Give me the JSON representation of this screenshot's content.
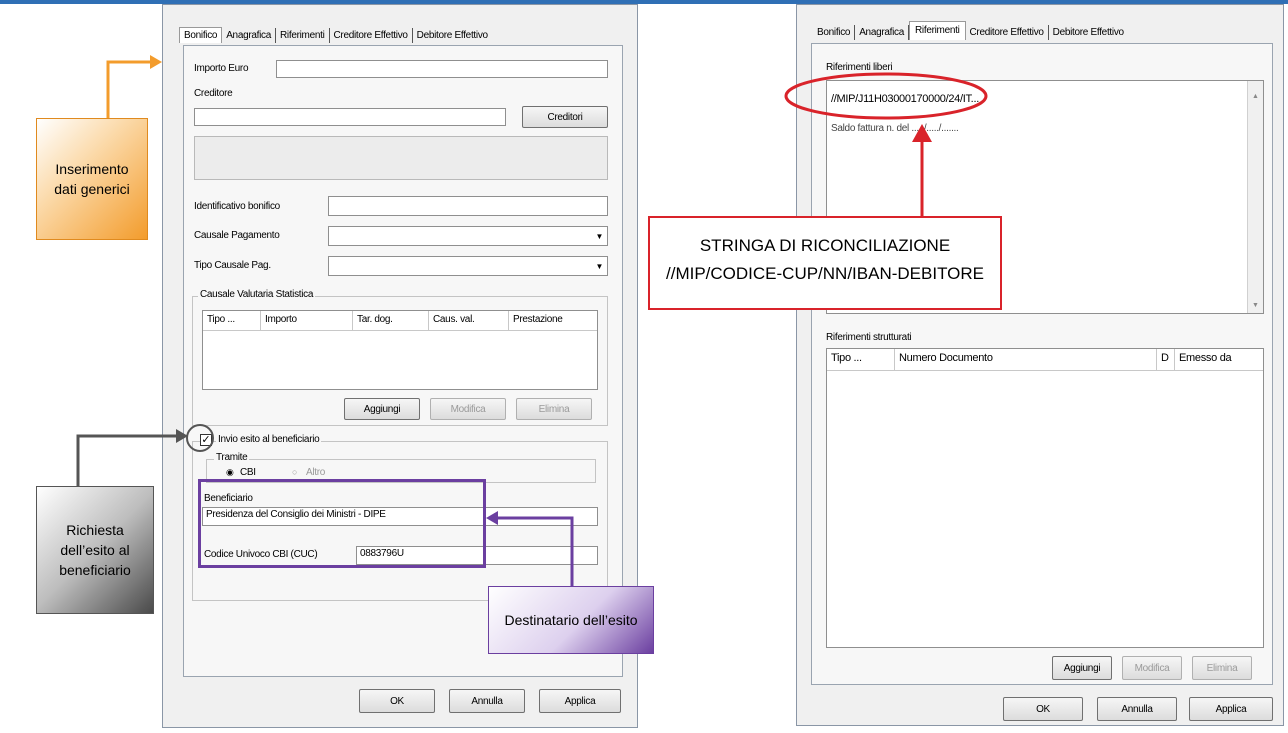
{
  "left_dialog": {
    "tabs": [
      "Bonifico",
      "Anagrafica",
      "Riferimenti",
      "Creditore Effettivo",
      "Debitore Effettivo"
    ],
    "importo_label": "Importo Euro",
    "importo_value": "",
    "creditore_label": "Creditore",
    "creditore_value": "",
    "creditori_button": "Creditori",
    "identificativo_label": "Identificativo bonifico",
    "identificativo_value": "",
    "causale_pagamento_label": "Causale Pagamento",
    "causale_pagamento_value": "",
    "tipo_causale_label": "Tipo Causale Pag.",
    "tipo_causale_value": "",
    "valutaria": {
      "title": "Causale Valutaria Statistica",
      "columns": [
        "Tipo ...",
        "Importo",
        "Tar. dog.",
        "Caus. val.",
        "Prestazione"
      ],
      "aggiungi": "Aggiungi",
      "modifica": "Modifica",
      "elimina": "Elimina"
    },
    "invio": {
      "checkbox_label": "Invio esito al beneficiario",
      "checked": true,
      "tramite_label": "Tramite",
      "options": [
        "CBI",
        "Altro"
      ],
      "selected": "CBI",
      "beneficiario_label": "Beneficiario",
      "beneficiario_value": "Presidenza del Consiglio dei Ministri - DIPE",
      "codice_label": "Codice Univoco CBI (CUC)",
      "codice_value": "0883796U"
    },
    "ok": "OK",
    "annulla": "Annulla",
    "applica": "Applica"
  },
  "right_dialog": {
    "tabs": [
      "Bonifico",
      "Anagrafica",
      "Riferimenti",
      "Creditore Effettivo",
      "Debitore Effettivo"
    ],
    "active_tab": "Riferimenti",
    "liberi_label": "Riferimenti liberi",
    "liberi_line1": "//MIP/J11H03000170000/24/IT...",
    "liberi_line2": "Saldo fattura n.        del ...../...../.......",
    "strutturati_label": "Riferimenti strutturati",
    "columns": [
      "Tipo ...",
      "Numero Documento",
      "D",
      "Emesso da"
    ],
    "aggiungi": "Aggiungi",
    "modifica": "Modifica",
    "elimina": "Elimina",
    "ok": "OK",
    "annulla": "Annulla",
    "applica": "Applica"
  },
  "callouts": {
    "inserimento": "Inserimento dati generici",
    "richiesta": "Richiesta dell’esito al beneficiario",
    "destinatario": "Destinatario dell’esito",
    "stringa_title": "STRINGA DI RICONCILIAZIONE",
    "stringa_format": "//MIP/CODICE-CUP/NN/IBAN-DEBITORE"
  },
  "colors": {
    "orange": "#f39c2c",
    "purple": "#6b3fa0",
    "red": "#d9232a",
    "gray_dark": "#555555"
  }
}
